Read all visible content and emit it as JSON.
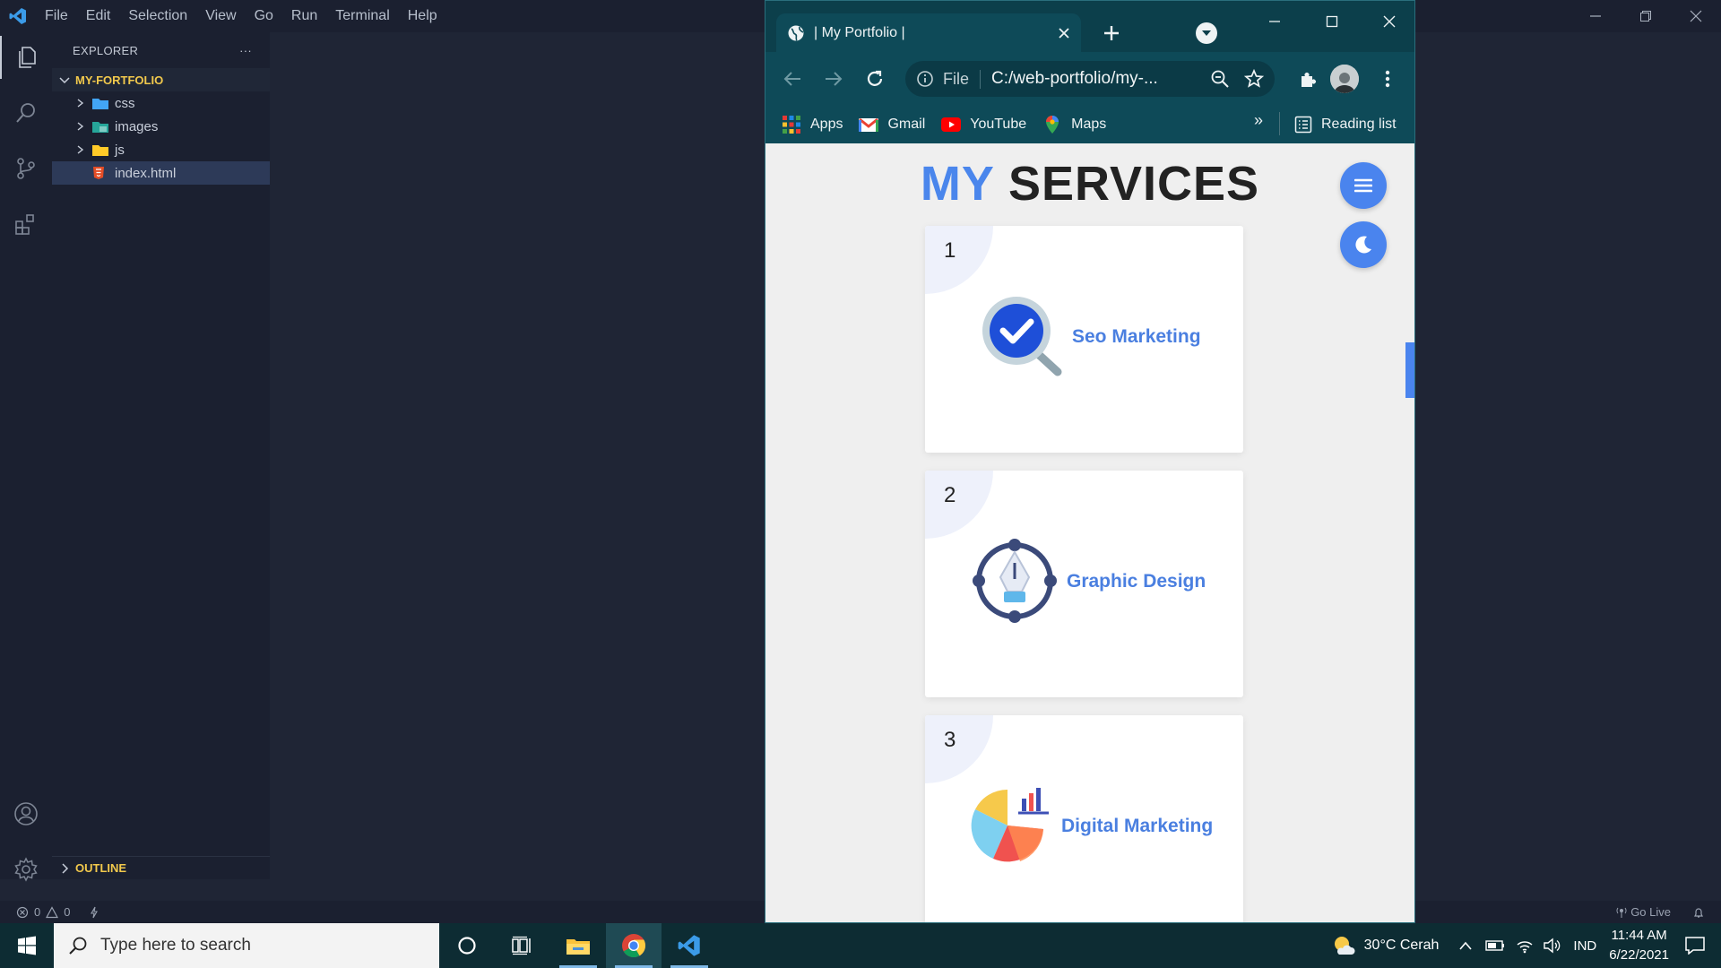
{
  "vscode": {
    "menu": [
      "File",
      "Edit",
      "Selection",
      "View",
      "Go",
      "Run",
      "Terminal",
      "Help"
    ],
    "explorer_title": "EXPLORER",
    "explorer_more": "···",
    "root_folder": "MY-FORTFOLIO",
    "tree": [
      {
        "label": "css",
        "type": "folder"
      },
      {
        "label": "images",
        "type": "folder"
      },
      {
        "label": "js",
        "type": "folder"
      },
      {
        "label": "index.html",
        "type": "file"
      }
    ],
    "outline": "OUTLINE",
    "status": {
      "errors": "0",
      "warnings": "0",
      "go_live": "Go Live"
    }
  },
  "browser": {
    "tab_title": "| My Portfolio |",
    "omnibox": {
      "scheme": "File",
      "url": "C:/web-portfolio/my-..."
    },
    "bookmarks": [
      {
        "label": "Apps",
        "icon": "apps-grid-icon"
      },
      {
        "label": "Gmail",
        "icon": "gmail-icon"
      },
      {
        "label": "YouTube",
        "icon": "youtube-icon"
      },
      {
        "label": "Maps",
        "icon": "maps-icon"
      }
    ],
    "more": "»",
    "reading_list": "Reading list",
    "accent": "#4a84ee"
  },
  "page": {
    "title_highlight": "MY",
    "title_rest": "SERVICES",
    "services": [
      {
        "number": "1",
        "name": "Seo Marketing",
        "icon": "seo-magnifier-icon"
      },
      {
        "number": "2",
        "name": "Graphic Design",
        "icon": "pen-tool-icon"
      },
      {
        "number": "3",
        "name": "Digital Marketing",
        "icon": "pie-chart-icon"
      }
    ]
  },
  "taskbar": {
    "search_placeholder": "Type here to search",
    "weather": "30°C Cerah",
    "language": "IND",
    "time": "11:44 AM",
    "date": "6/22/2021"
  }
}
